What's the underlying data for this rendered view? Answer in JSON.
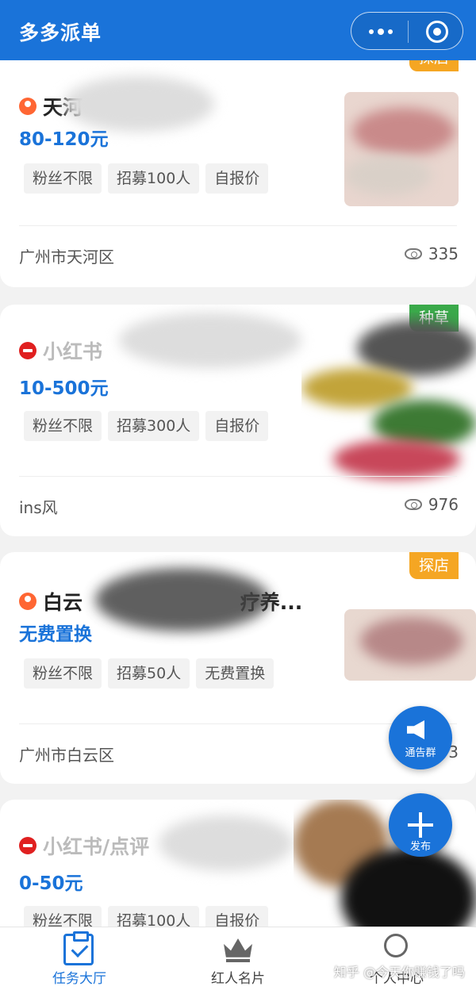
{
  "header": {
    "title": "多多派单"
  },
  "cards": [
    {
      "badge": "探店",
      "title_visible": "天河",
      "price": "80-120元",
      "chips": [
        "粉丝不限",
        "招募100人",
        "自报价"
      ],
      "location": "广州市天河区",
      "views": "335"
    },
    {
      "badge": "种草",
      "title_visible": "小红书",
      "price": "10-500元",
      "chips": [
        "粉丝不限",
        "招募300人",
        "自报价"
      ],
      "location": "ins风",
      "views": "976"
    },
    {
      "badge": "探店",
      "title_visible": "白云",
      "title_tail": "疗养...",
      "price": "无费置换",
      "chips": [
        "粉丝不限",
        "招募50人",
        "无费置换"
      ],
      "location": "广州市白云区",
      "views": "3"
    },
    {
      "title_visible": "小红书/点评",
      "price": "0-50元",
      "chips": [
        "粉丝不限",
        "招募100人",
        "自报价"
      ]
    }
  ],
  "fab": {
    "group_label": "通告群",
    "add_label": "发布"
  },
  "tabbar": [
    {
      "label": "任务大厅",
      "icon": "clipboard-check-icon",
      "active": true
    },
    {
      "label": "红人名片",
      "icon": "crown-icon",
      "active": false
    },
    {
      "label": "个人中心",
      "icon": "user-icon",
      "active": false
    }
  ],
  "watermark": "知乎 @今天你赚钱了吗",
  "colors": {
    "primary": "#1a73d9",
    "badge_orange": "#f5a623",
    "badge_green": "#3aa94a",
    "background": "#f2f2f2"
  }
}
